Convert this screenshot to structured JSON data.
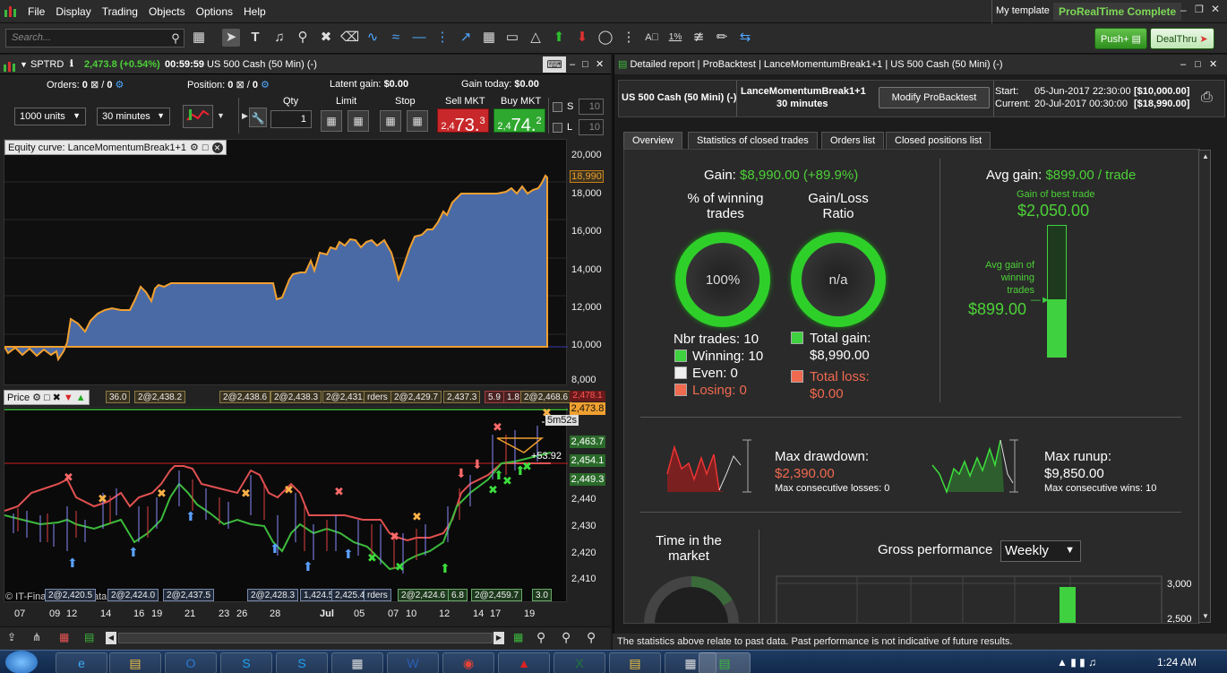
{
  "menu": {
    "items": [
      "File",
      "Display",
      "Trading",
      "Objects",
      "Options",
      "Help"
    ],
    "template_label": "My template",
    "edition": "ProRealTime Complete"
  },
  "toolbar": {
    "search_placeholder": "Search...",
    "push_label": "Push+",
    "dealthru_label": "DealThru"
  },
  "left": {
    "instrument": "SPTRD",
    "price_change": "2,473.8 (+0.54%)",
    "time": "00:59:59",
    "title": "US 500 Cash (50 Min) (-)",
    "orders_label": "Orders:",
    "orders_value": "0",
    "orders_value2": "0",
    "position_label": "Position:",
    "position_value": "0",
    "position_value2": "0",
    "latent_label": "Latent gain:",
    "latent_value": "$0.00",
    "gaintoday_label": "Gain today:",
    "gaintoday_value": "$0.00",
    "units": "1000 units",
    "timeframe": "30 minutes",
    "qty_label": "Qty",
    "qty_value": "1",
    "limit_label": "Limit",
    "stop_label": "Stop",
    "sell_label": "Sell MKT",
    "buy_label": "Buy MKT",
    "sell_prefix": "2,4",
    "sell_big": "73.",
    "sell_sup": "3",
    "buy_prefix": "2,4",
    "buy_big": "74.",
    "buy_sup": "2",
    "s_label": "S",
    "l_label": "L",
    "s_value": "10",
    "l_value": "10",
    "equity_title": "Equity curve: LanceMomentumBreak1+1",
    "equity_axis": [
      "20,000",
      "18,000",
      "16,000",
      "14,000",
      "12,000",
      "10,000",
      "8,000"
    ],
    "equity_last": "18,990",
    "price_title": "Price",
    "price_axis": [
      "2,440",
      "2,430",
      "2,420",
      "2,410"
    ],
    "price_tags": [
      "2,473.8",
      "2,463.7",
      "2,454.1",
      "2,449.3"
    ],
    "price_last_red": "2,478.1",
    "timer": "5m52s",
    "line_value": "53.92",
    "copyright": "© IT-Finance.com Data Interactive",
    "top_order_tags": [
      "36.0",
      "2@2,438.2",
      "2@2,438.6",
      "2@2,438.3",
      "2@2,431.1",
      "rders",
      "2@2,429.7",
      "2,437.3",
      "5.9",
      "1.8",
      "2@2,468.6"
    ],
    "bottom_order_tags": [
      "2@2,420.5",
      "2@2,424.0",
      "2@2,437.5",
      "2@2,428.3",
      "1,424.5",
      "2,425.4",
      "rders",
      "2@2,424.6",
      "6.8",
      "2@2,459.7",
      "3.0"
    ],
    "dates": [
      "07",
      "09",
      "12",
      "14",
      "16",
      "19",
      "21",
      "23",
      "26",
      "28",
      "Jul",
      "05",
      "07",
      "10",
      "12",
      "14",
      "17",
      "19"
    ]
  },
  "right": {
    "tabs_header": [
      "Detailed report",
      "ProBacktest",
      "LanceMomentumBreak1+1",
      "US 500 Cash (50 Mini) (-)"
    ],
    "instrument": "US 500 Cash (50 Mini) (-)",
    "strategy": "LanceMomentumBreak1+1",
    "strategy_tf": "30 minutes",
    "modify_label": "Modify ProBacktest",
    "start_label": "Start:",
    "start_value": "05-Jun-2017 22:30:00",
    "start_amount": "[$10,000.00]",
    "current_label": "Current:",
    "current_value": "20-Jul-2017 00:30:00",
    "current_amount": "[$18,990.00]",
    "tabs": [
      "Overview",
      "Statistics of closed trades",
      "Orders list",
      "Closed positions list"
    ],
    "gain_label": "Gain:",
    "gain_value": "$8,990.00 (+89.9%)",
    "winning_pct_label": "% of winning trades",
    "winning_pct_value": "100%",
    "gainloss_label": "Gain/Loss Ratio",
    "gainloss_value": "n/a",
    "nbr_trades": "Nbr trades: 10",
    "winning": "Winning: 10",
    "even": "Even: 0",
    "losing": "Losing: 0",
    "total_gain_label": "Total gain:",
    "total_gain_value": "$8,990.00",
    "total_loss_label": "Total loss:",
    "total_loss_value": "$0.00",
    "avg_gain_label": "Avg gain:",
    "avg_gain_value": "$899.00 / trade",
    "best_trade_label": "Gain of best trade",
    "best_trade_value": "$2,050.00",
    "avg_winning_label": "Avg gain of winning trades",
    "avg_winning_value": "$899.00",
    "avg_gain_fill_fraction": 0.44,
    "max_drawdown_label": "Max drawdown:",
    "max_drawdown_value": "$2,390.00",
    "max_losses_label": "Max consecutive losses: 0",
    "max_runup_label": "Max runup:",
    "max_runup_value": "$9,850.00",
    "max_wins_label": "Max consecutive wins: 10",
    "time_market_label": "Time in the market",
    "gross_label": "Gross performance",
    "gross_period": "Weekly",
    "gross_axis": [
      "3,000",
      "2,500"
    ],
    "disclaimer": "The statistics above relate to past data. Past performance is not indicative of future results."
  },
  "taskbar": {
    "time": "1:24 AM"
  }
}
